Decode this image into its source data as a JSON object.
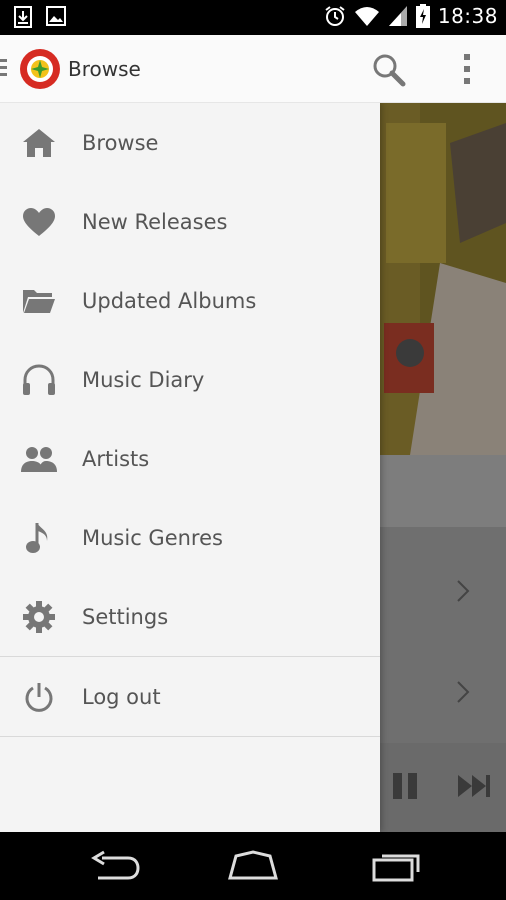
{
  "status_bar": {
    "time": "18:38",
    "left_icons": [
      "download-icon",
      "image-icon"
    ],
    "right_icons": [
      "alarm-icon",
      "wifi-icon",
      "signal-icon",
      "battery-charging-icon"
    ]
  },
  "app_bar": {
    "title": "Browse",
    "logo_icon": "app-logo",
    "actions": [
      "search-icon",
      "overflow-menu-icon"
    ]
  },
  "drawer": {
    "items": [
      {
        "label": "Browse",
        "icon": "home-icon"
      },
      {
        "label": "New Releases",
        "icon": "heart-icon"
      },
      {
        "label": "Updated Albums",
        "icon": "folder-icon"
      },
      {
        "label": "Music Diary",
        "icon": "headphones-icon"
      },
      {
        "label": "Artists",
        "icon": "people-icon"
      },
      {
        "label": "Music Genres",
        "icon": "music-note-icon"
      },
      {
        "label": "Settings",
        "icon": "gear-icon"
      }
    ],
    "footer_items": [
      {
        "label": "Log out",
        "icon": "power-icon"
      }
    ]
  },
  "player": {
    "controls": [
      "pause-icon",
      "skip-next-icon"
    ]
  },
  "nav_bar": {
    "buttons": [
      "back-icon",
      "home-nav-icon",
      "recents-icon"
    ]
  },
  "colors": {
    "drawer_bg": "#f4f4f4",
    "icon_gray": "#777777",
    "text_gray": "#555555",
    "logo_red": "#d62b22"
  }
}
